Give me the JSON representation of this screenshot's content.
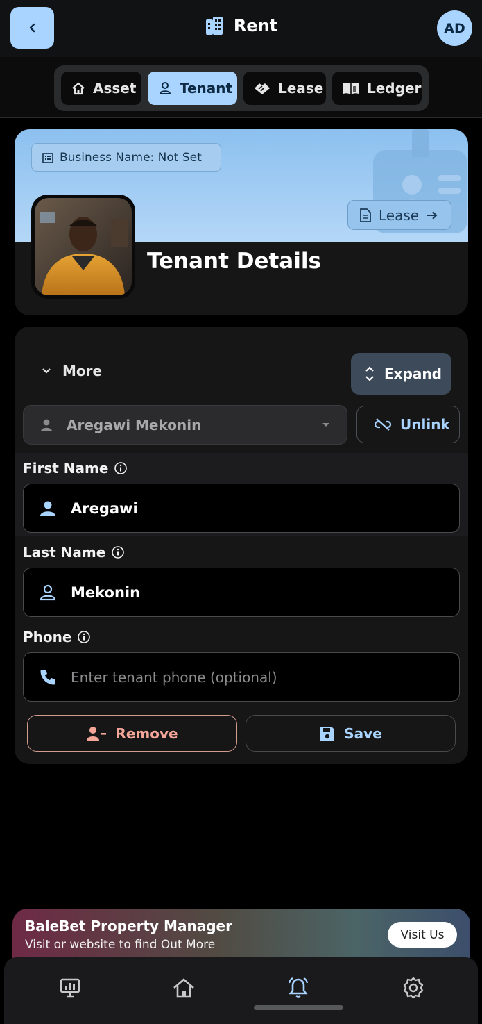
{
  "header": {
    "title": "Rent",
    "avatar_initials": "AD",
    "back_icon": "chevron-left-icon",
    "title_icon": "building-icon"
  },
  "tabs": [
    {
      "label": "Asset",
      "icon": "house-icon",
      "active": false
    },
    {
      "label": "Tenant",
      "icon": "person-icon",
      "active": true
    },
    {
      "label": "Lease",
      "icon": "handshake-icon",
      "active": false
    },
    {
      "label": "Ledger",
      "icon": "book-icon",
      "active": false
    }
  ],
  "tenant_card": {
    "business_chip": "Business Name: Not Set",
    "lease_chip": "Lease",
    "title": "Tenant Details"
  },
  "form": {
    "more_label": "More",
    "expand_label": "Expand",
    "tenant_select_value": "Aregawi Mekonin",
    "unlink_label": "Unlink",
    "first_name": {
      "label": "First Name",
      "value": "Aregawi"
    },
    "last_name": {
      "label": "Last Name",
      "value": "Mekonin"
    },
    "phone": {
      "label": "Phone",
      "value": "",
      "placeholder": "Enter tenant phone (optional)"
    },
    "remove_label": "Remove",
    "save_label": "Save"
  },
  "banner": {
    "title": "BaleBet Property Manager",
    "subtitle": "Visit or website to find Out More",
    "button": "Visit Us"
  },
  "bottom_nav": [
    {
      "icon": "presentation-chart-icon",
      "active": false
    },
    {
      "icon": "home-icon",
      "active": false
    },
    {
      "icon": "bell-icon",
      "active": true
    },
    {
      "icon": "gear-icon",
      "active": false
    }
  ],
  "colors": {
    "accent": "#a9d4ff",
    "danger": "#f3a698",
    "background": "#000000",
    "surface": "#161617"
  }
}
